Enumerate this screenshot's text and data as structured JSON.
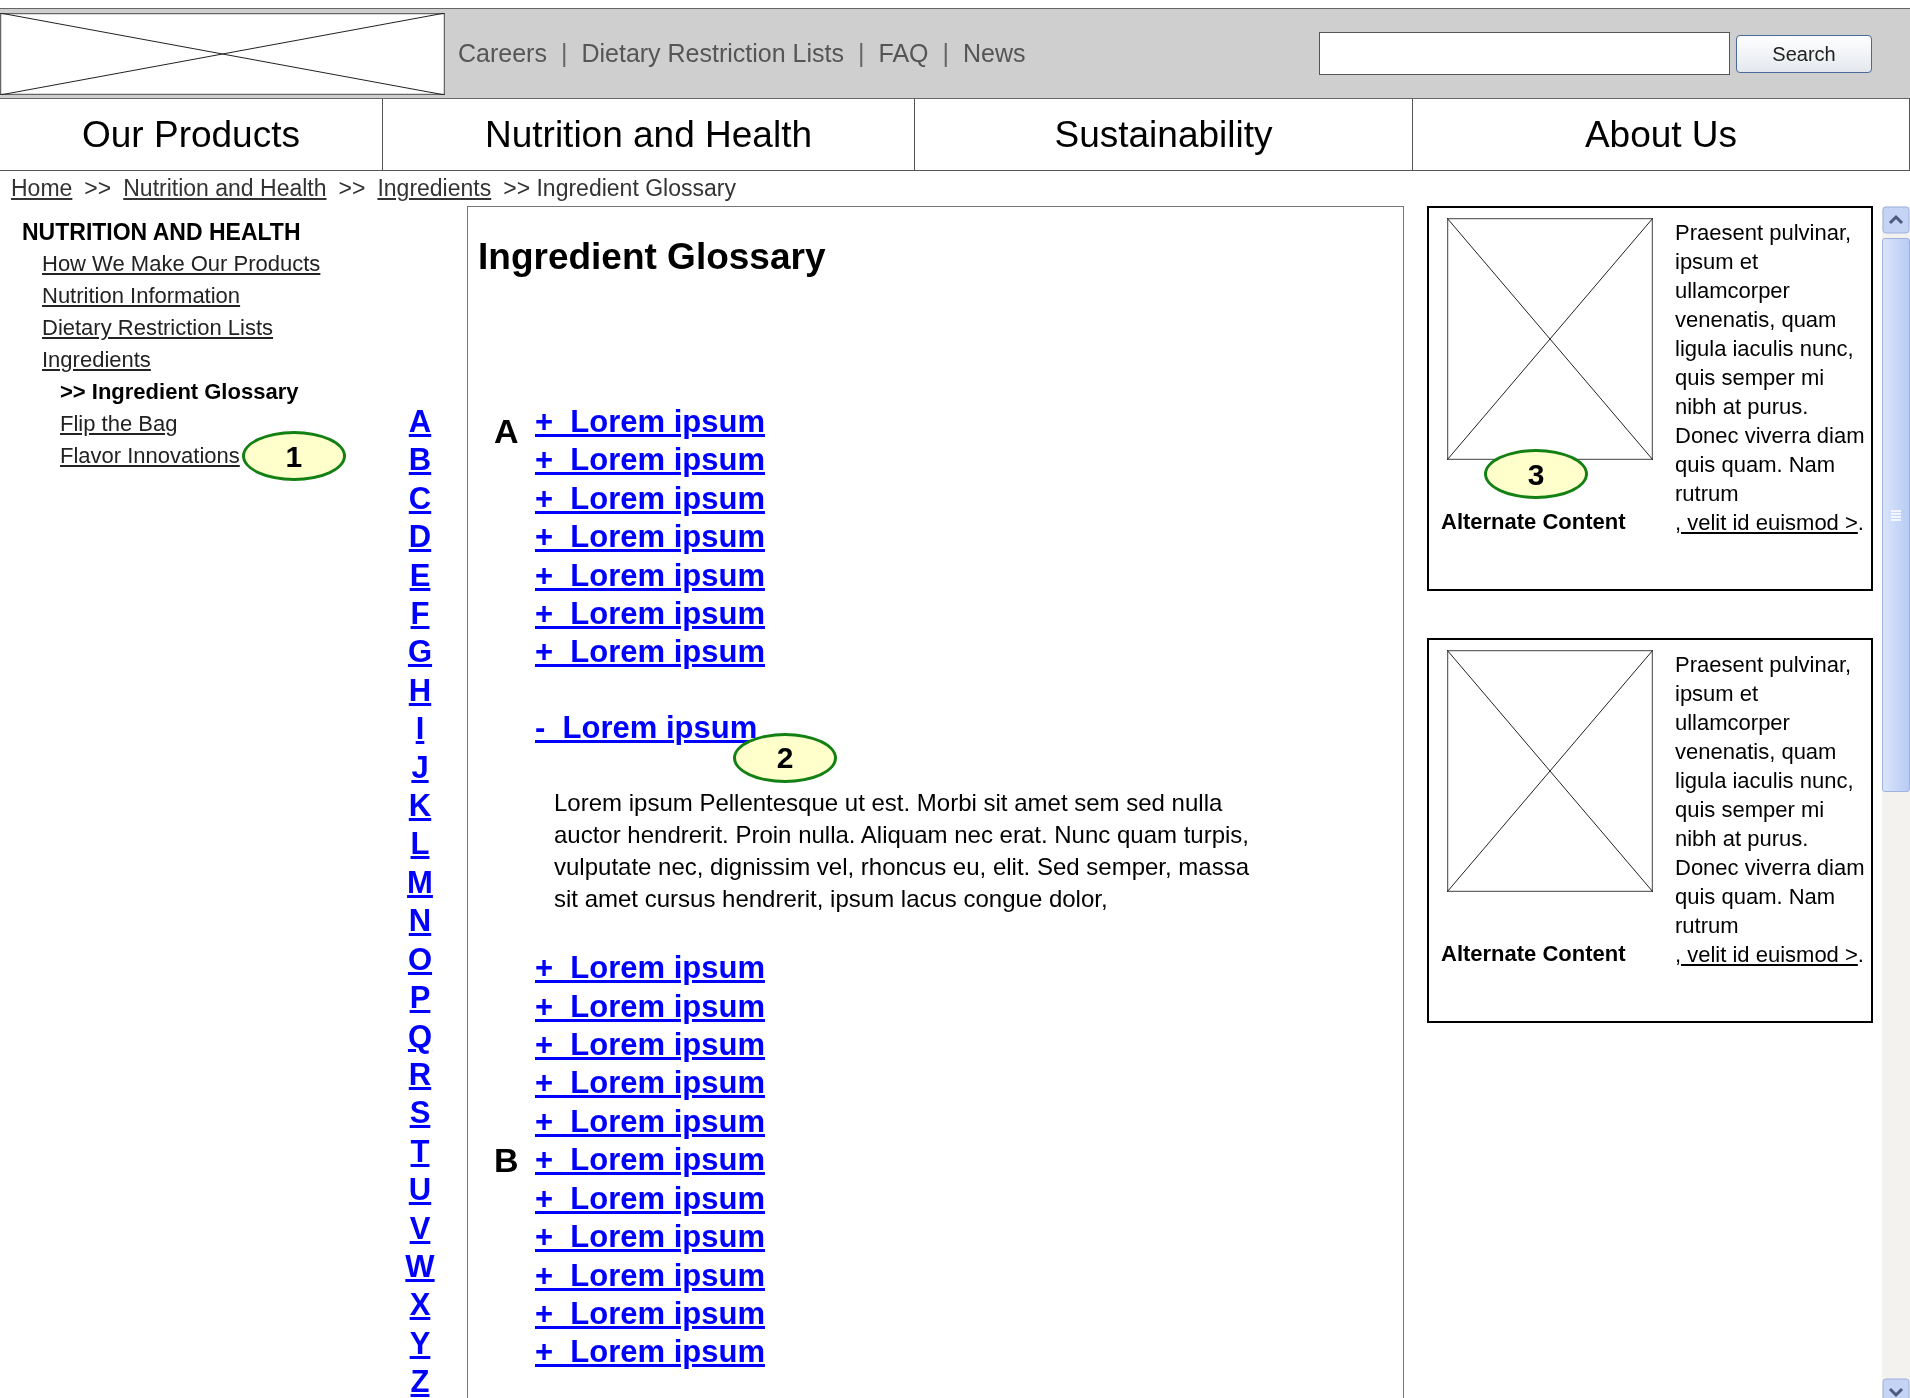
{
  "header": {
    "top_links": [
      {
        "kind": "link",
        "label": "Careers"
      },
      {
        "kind": "separator",
        "label": "|"
      },
      {
        "kind": "link",
        "label": "Dietary Restriction Lists"
      },
      {
        "kind": "separator",
        "label": "|"
      },
      {
        "kind": "link",
        "label": "FAQ"
      },
      {
        "kind": "separator",
        "label": "|"
      },
      {
        "kind": "link",
        "label": "News"
      }
    ],
    "search_button": "Search"
  },
  "nav": [
    "Our Products",
    "Nutrition and Health",
    "Sustainability",
    "About Us"
  ],
  "breadcrumb": [
    {
      "label": "Home",
      "link": true
    },
    {
      "label": ">>",
      "link": false
    },
    {
      "label": "Nutrition and Health",
      "link": true
    },
    {
      "label": ">>",
      "link": false
    },
    {
      "label": "Ingredients",
      "link": true
    },
    {
      "label": ">> Ingredient Glossary",
      "link": false
    }
  ],
  "sidebar": {
    "title": "NUTRITION AND HEALTH",
    "items": [
      {
        "label": "How We Make Our Products",
        "selected": false
      },
      {
        "label": "Nutrition Information",
        "selected": false
      },
      {
        "label": "Dietary Restriction Lists",
        "selected": false
      },
      {
        "label": "Ingredients",
        "selected": false,
        "children": [
          {
            "label": ">> Ingredient Glossary",
            "selected": true
          },
          {
            "label": "Flip the Bag",
            "selected": false
          },
          {
            "label": "Flavor Innovations",
            "selected": false,
            "callout": "1"
          }
        ]
      }
    ]
  },
  "letters": [
    "A",
    "B",
    "C",
    "D",
    "E",
    "F",
    "G",
    "H",
    "I",
    "J",
    "K",
    "L",
    "M",
    "N",
    "O",
    "P",
    "Q",
    "R",
    "S",
    "T",
    "U",
    "V",
    "W",
    "X",
    "Y",
    "Z"
  ],
  "content": {
    "title": "Ingredient Glossary",
    "sections": [
      {
        "letter": "A",
        "entries": [
          {
            "label": "+  Lorem ipsum",
            "expanded": false
          },
          {
            "label": "+  Lorem ipsum",
            "expanded": false
          },
          {
            "label": "+  Lorem ipsum",
            "expanded": false
          },
          {
            "label": "+  Lorem ipsum",
            "expanded": false
          },
          {
            "label": "+  Lorem ipsum",
            "expanded": false
          },
          {
            "label": "+  Lorem ipsum",
            "expanded": false
          },
          {
            "label": "+  Lorem ipsum",
            "expanded": false
          },
          {
            "label": "-  Lorem ipsum",
            "expanded": true,
            "callout": "2",
            "description": "Lorem ipsum Pellentesque ut est. Morbi sit amet sem sed nulla auctor hendrerit. Proin nulla. Aliquam nec erat. Nunc quam turpis, vulputate nec, dignissim vel, rhoncus eu, elit. Sed semper, massa sit amet cursus hendrerit, ipsum lacus congue dolor,"
          }
        ]
      },
      {
        "letter": "B",
        "entries": [
          {
            "label": "+  Lorem ipsum",
            "expanded": false
          },
          {
            "label": "+  Lorem ipsum",
            "expanded": false
          },
          {
            "label": "+  Lorem ipsum",
            "expanded": false
          },
          {
            "label": "+  Lorem ipsum",
            "expanded": false
          },
          {
            "label": "+  Lorem ipsum",
            "expanded": false
          },
          {
            "label": "+  Lorem ipsum",
            "expanded": false
          },
          {
            "label": "+  Lorem ipsum",
            "expanded": false
          },
          {
            "label": "+  Lorem ipsum",
            "expanded": false
          },
          {
            "label": "+  Lorem ipsum",
            "expanded": false
          },
          {
            "label": "+  Lorem ipsum",
            "expanded": false
          },
          {
            "label": "+  Lorem ipsum",
            "expanded": false
          }
        ]
      }
    ]
  },
  "cards": [
    {
      "caption": "Alternate Content",
      "callout": "3",
      "text": "Praesent pulvinar, ipsum et ullamcorper venenatis, quam ligula iaculis nunc, quis semper mi nibh at purus. Donec viverra diam quis quam. Nam rutrum",
      "link": ", velit id euismod >",
      "tail": "."
    },
    {
      "caption": "Alternate Content",
      "text": "Praesent pulvinar, ipsum et ullamcorper venenatis, quam ligula iaculis nunc, quis semper mi nibh at purus. Donec viverra diam quis quam. Nam rutrum",
      "link": ", velit id euismod >",
      "tail": "."
    }
  ]
}
